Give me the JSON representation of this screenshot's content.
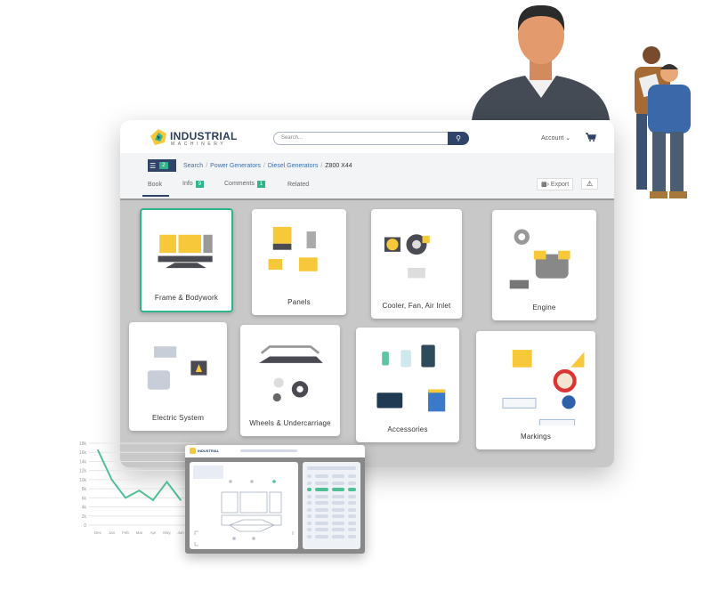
{
  "brand": {
    "name": "INDUSTRIAL",
    "tagline": "MACHINERY"
  },
  "header": {
    "search_placeholder": "Search...",
    "account_label": "Account"
  },
  "toolbar": {
    "list_count": "2"
  },
  "breadcrumb": [
    "Search",
    "Power Generators",
    "Diesel Generators",
    "Z800 X44"
  ],
  "tabs": [
    {
      "label": "Book"
    },
    {
      "label": "Info",
      "badge": "9"
    },
    {
      "label": "Comments",
      "badge": "1"
    },
    {
      "label": "Related"
    }
  ],
  "actions": {
    "export_label": "Export"
  },
  "cards": [
    {
      "label": "Frame & Bodywork",
      "selected": true
    },
    {
      "label": "Panels"
    },
    {
      "label": "Cooler, Fan, Air Inlet"
    },
    {
      "label": "Engine"
    },
    {
      "label": "Electric System"
    },
    {
      "label": "Wheels & Undercarriage"
    },
    {
      "label": "Accessories"
    },
    {
      "label": "Markings"
    }
  ],
  "mini_window": {
    "brand": "INDUSTRIAL"
  },
  "chart_data": {
    "type": "line",
    "categories": [
      "Dec",
      "Jan",
      "Feb",
      "Mar",
      "Apr",
      "May",
      "Jun"
    ],
    "values": [
      16500,
      10000,
      6000,
      7600,
      5500,
      9500,
      5500
    ],
    "yticks": [
      "18k",
      "16k",
      "14k",
      "12k",
      "10k",
      "8k",
      "6k",
      "4k",
      "2k",
      "0"
    ],
    "ylim": [
      0,
      18000
    ],
    "grid": true,
    "color": "#4fc095"
  },
  "colors": {
    "accent": "#2fb48c",
    "navy": "#2f4468",
    "yellow": "#f7c83a"
  }
}
